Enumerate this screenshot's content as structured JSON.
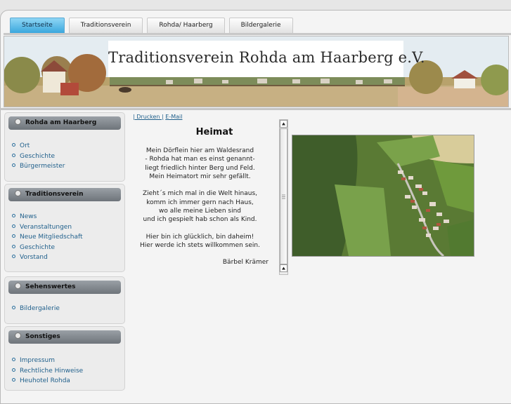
{
  "nav": {
    "tabs": [
      "Startseite",
      "Traditionsverein",
      "Rohda/ Haarberg",
      "Bildergalerie"
    ],
    "active_tab": "Startseite"
  },
  "header": {
    "title": "Traditionsverein Rohda am Haarberg e.V."
  },
  "sidebar": {
    "boxes": [
      {
        "title": "Rohda am Haarberg",
        "items": [
          "Ort",
          "Geschichte",
          "Bürgermeister"
        ]
      },
      {
        "title": "Traditionsverein",
        "items": [
          "News",
          "Veranstaltungen",
          "Neue Mitgliedschaft",
          "Geschichte",
          "Vorstand"
        ]
      },
      {
        "title": "Sehenswertes",
        "items": [
          "Bildergalerie"
        ]
      },
      {
        "title": "Sonstiges",
        "items": [
          "Impressum",
          "Rechtliche Hinweise",
          "Heuhotel Rohda"
        ]
      }
    ]
  },
  "content": {
    "links": {
      "print": "| Drucken |",
      "email": "E-Mail"
    },
    "poem_title": "Heimat",
    "poem_lines": [
      "Mein Dörflein hier am Waldesrand",
      "- Rohda hat man es einst genannt-",
      "liegt friedlich hinter Berg und Feld.",
      "Mein Heimatort mir sehr gefällt.",
      "",
      "Zieht´s mich mal in die Welt hinaus,",
      "komm ich immer gern nach Haus,",
      "wo alle meine Lieben sind",
      "und ich gespielt hab schon als Kind.",
      "",
      "Hier bin ich glücklich, bin daheim!",
      "Hier werde ich stets willkommen sein."
    ],
    "author": "Bärbel Krämer"
  },
  "colors": {
    "accent_tab": "#3aa7dd",
    "link": "#1f5f8b",
    "box_header": "#6e747a"
  },
  "icons": {
    "scroll_up": "triangle-up-icon",
    "scroll_down": "triangle-up-icon"
  }
}
